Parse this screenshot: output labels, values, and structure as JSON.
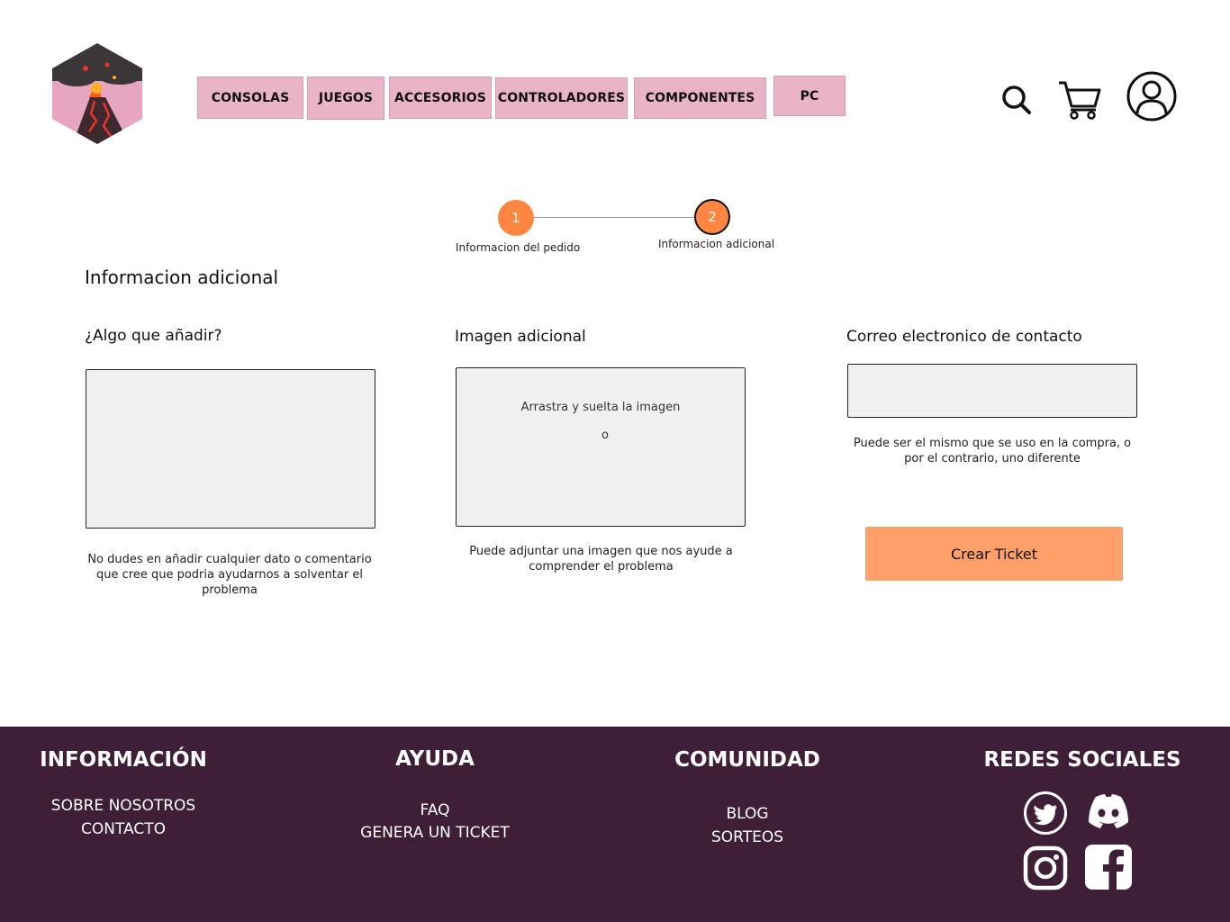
{
  "header": {
    "nav": [
      {
        "label": "CONSOLAS"
      },
      {
        "label": "JUEGOS"
      },
      {
        "label": "ACCESORIOS"
      },
      {
        "label": "CONTROLADORES"
      },
      {
        "label": "COMPONENTES"
      },
      {
        "label": "PC"
      }
    ],
    "icons": [
      "search-icon",
      "cart-icon",
      "user-icon"
    ]
  },
  "stepper": {
    "steps": [
      {
        "number": "1",
        "label": "Informacion del pedido"
      },
      {
        "number": "2",
        "label": "Informacion adicional"
      }
    ],
    "current": 2
  },
  "form": {
    "title": "Informacion adicional",
    "comment": {
      "label": "¿Algo que añadir?",
      "value": "",
      "help": "No dudes en añadir cualquier dato o comentario que cree que podria ayudarnos a solventar el problema"
    },
    "image": {
      "label": "Imagen adicional",
      "drop_text": "Arrastra y suelta la imagen",
      "or_text": "o",
      "help": "Puede adjuntar una imagen que nos ayude a comprender el problema"
    },
    "email": {
      "label": "Correo electronico de contacto",
      "value": "",
      "help": "Puede ser el mismo que se uso en la compra, o por el contrario, uno diferente"
    },
    "submit_label": "Crear Ticket"
  },
  "footer": {
    "informacion": {
      "title": "INFORMACIÓN",
      "links": [
        "SOBRE NOSOTROS",
        "CONTACTO"
      ]
    },
    "ayuda": {
      "title": "AYUDA",
      "links": [
        "FAQ",
        "GENERA UN TICKET"
      ]
    },
    "comunidad": {
      "title": "COMUNIDAD",
      "links": [
        "BLOG",
        "SORTEOS"
      ]
    },
    "redes": {
      "title": "REDES SOCIALES",
      "icons": [
        "twitter-icon",
        "discord-icon",
        "instagram-icon",
        "facebook-icon"
      ]
    }
  },
  "colors": {
    "nav_bg": "#e8b4c6",
    "accent": "#ff8640",
    "cta": "#ffa06b",
    "footer_bg": "#3e1f37",
    "field_bg": "#f0f0f0"
  }
}
